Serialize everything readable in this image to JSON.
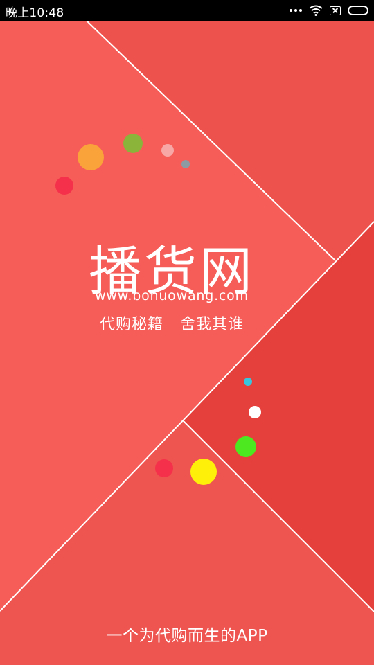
{
  "status_bar": {
    "time": "晚上10:48",
    "icons": [
      "more-dots-icon",
      "wifi-icon",
      "no-sim-icon",
      "battery-icon"
    ]
  },
  "splash": {
    "brand_name": "播货网",
    "url": "www.bohuowang.com",
    "slogan_left": "代购秘籍",
    "slogan_right": "舍我其谁",
    "footer": "一个为代购而生的APP"
  },
  "colors": {
    "background_top_left": "#F65C58",
    "background_top_right": "#EE524C",
    "background_right": "#E5403C",
    "background_bottom": "#EE5450",
    "divider_line": "#FFFFFF",
    "dot_red": "#F5304A",
    "dot_orange": "#F9A33A",
    "dot_olive": "#8BB43A",
    "dot_pink": "#F7A8A6",
    "dot_gray": "#8E9AA2",
    "dot_cyan": "#38C6DE",
    "dot_white": "#FFFFFF",
    "dot_green": "#4DE81F",
    "dot_yellow": "#FFF00A"
  }
}
